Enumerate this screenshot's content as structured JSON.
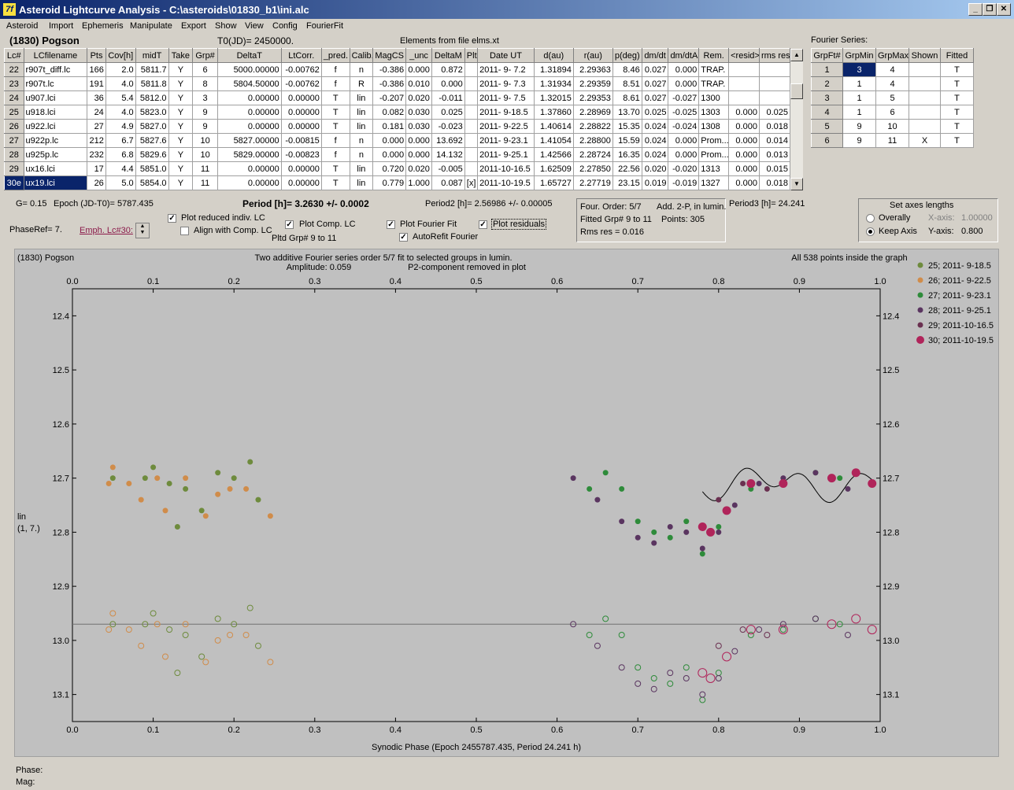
{
  "window": {
    "title": "Asteroid Lightcurve Analysis - C:\\asteroids\\01830_b1\\ini.alc",
    "app_icon": "7f"
  },
  "menu": [
    "Asteroid",
    "Import",
    "Ephemeris",
    "Manipulate",
    "Export",
    "Show",
    "View",
    "Config",
    "FourierFit"
  ],
  "header": {
    "object": "(1830) Pogson",
    "t0": "T0(JD)= 2450000.",
    "elements": "Elements from file elms.xt",
    "fourier_series_label": "Fourier Series:"
  },
  "lc_table": {
    "columns": [
      "Lc#",
      "LCfilename",
      "Pts",
      "Cov[h]",
      "midT",
      "Take",
      "Grp#",
      "DeltaT",
      "LtCorr.",
      "_pred.",
      "Calib.",
      "MagCS",
      "_unc",
      "DeltaM",
      "Plt",
      "Date UT",
      "d(au)",
      "r(au)",
      "p(deg)",
      "dm/dt",
      "dm/dtA",
      "Rem.",
      "<resid>",
      "rms res"
    ],
    "rows": [
      [
        "22",
        "r907t_diff.lc",
        "166",
        "2.0",
        "5811.7",
        "Y",
        "6",
        "5000.00000",
        "-0.00762",
        "f",
        "n",
        "-0.386",
        "0.000",
        "0.872",
        "",
        "2011- 9- 7.2",
        "1.31894",
        "2.29363",
        "8.46",
        "0.027",
        "0.000",
        "TRAP.",
        "",
        ""
      ],
      [
        "23",
        "r907t.lc",
        "191",
        "4.0",
        "5811.8",
        "Y",
        "8",
        "5804.50000",
        "-0.00762",
        "f",
        "R",
        "-0.386",
        "0.010",
        "0.000",
        "",
        "2011- 9- 7.3",
        "1.31934",
        "2.29359",
        "8.51",
        "0.027",
        "0.000",
        "TRAP.",
        "",
        ""
      ],
      [
        "24",
        "u907.lci",
        "36",
        "5.4",
        "5812.0",
        "Y",
        "3",
        "0.00000",
        "0.00000",
        "T",
        "lin",
        "-0.207",
        "0.020",
        "-0.011",
        "",
        "2011- 9- 7.5",
        "1.32015",
        "2.29353",
        "8.61",
        "0.027",
        "-0.027",
        "1300",
        "",
        ""
      ],
      [
        "25",
        "u918.lci",
        "24",
        "4.0",
        "5823.0",
        "Y",
        "9",
        "0.00000",
        "0.00000",
        "T",
        "lin",
        "0.082",
        "0.030",
        "0.025",
        "",
        "2011- 9-18.5",
        "1.37860",
        "2.28969",
        "13.70",
        "0.025",
        "-0.025",
        "1303",
        "0.000",
        "0.025"
      ],
      [
        "26",
        "u922.lci",
        "27",
        "4.9",
        "5827.0",
        "Y",
        "9",
        "0.00000",
        "0.00000",
        "T",
        "lin",
        "0.181",
        "0.030",
        "-0.023",
        "",
        "2011- 9-22.5",
        "1.40614",
        "2.28822",
        "15.35",
        "0.024",
        "-0.024",
        "1308",
        "0.000",
        "0.018"
      ],
      [
        "27",
        "u922p.lc",
        "212",
        "6.7",
        "5827.6",
        "Y",
        "10",
        "5827.00000",
        "-0.00815",
        "f",
        "n",
        "0.000",
        "0.000",
        "13.692",
        "",
        "2011- 9-23.1",
        "1.41054",
        "2.28800",
        "15.59",
        "0.024",
        "0.000",
        "Prom...",
        "0.000",
        "0.014"
      ],
      [
        "28",
        "u925p.lc",
        "232",
        "6.8",
        "5829.6",
        "Y",
        "10",
        "5829.00000",
        "-0.00823",
        "f",
        "n",
        "0.000",
        "0.000",
        "14.132",
        "",
        "2011- 9-25.1",
        "1.42566",
        "2.28724",
        "16.35",
        "0.024",
        "0.000",
        "Prom...",
        "0.000",
        "0.013"
      ],
      [
        "29",
        "ux16.lci",
        "17",
        "4.4",
        "5851.0",
        "Y",
        "11",
        "0.00000",
        "0.00000",
        "T",
        "lin",
        "0.720",
        "0.020",
        "-0.005",
        "",
        "2011-10-16.5",
        "1.62509",
        "2.27850",
        "22.56",
        "0.020",
        "-0.020",
        "1313",
        "0.000",
        "0.015"
      ],
      [
        "30e",
        "ux19.lci",
        "26",
        "5.0",
        "5854.0",
        "Y",
        "11",
        "0.00000",
        "0.00000",
        "T",
        "lin",
        "0.779",
        "1.000",
        "0.087",
        "[x]",
        "2011-10-19.5",
        "1.65727",
        "2.27719",
        "23.15",
        "0.019",
        "-0.019",
        "1327",
        "0.000",
        "0.018"
      ]
    ]
  },
  "fourier_table": {
    "columns": [
      "GrpFt#",
      "GrpMin",
      "GrpMax",
      "Shown",
      "Fitted"
    ],
    "rows": [
      [
        "1",
        "3",
        "4",
        "",
        "T"
      ],
      [
        "2",
        "1",
        "4",
        "",
        "T"
      ],
      [
        "3",
        "1",
        "5",
        "",
        "T"
      ],
      [
        "4",
        "1",
        "6",
        "",
        "T"
      ],
      [
        "5",
        "9",
        "10",
        "",
        "T"
      ],
      [
        "6",
        "9",
        "11",
        "X",
        "T"
      ]
    ]
  },
  "controls": {
    "g": "G= 0.15",
    "epoch": "Epoch (JD-T0)= 5787.435",
    "period": "Period [h]= 3.2630 +/- 0.0002",
    "period2": "Period2 [h]= 2.56986 +/- 0.00005",
    "period3": "Period3 [h]= 24.241",
    "phaseref": "PhaseRef= 7.",
    "emph": "Emph. Lc#30:",
    "plot_reduced": "Plot reduced indiv. LC",
    "align_comp": "Align with Comp. LC",
    "plot_comp": "Plot Comp. LC",
    "pltd_grp": "Pltd Grp#  9   to   11",
    "plot_fourier": "Plot Fourier Fit",
    "autorefit": "AutoRefit Fourier",
    "plot_residuals": "Plot residuals",
    "four_order": "Four. Order:  5/7",
    "add_2p": "Add. 2-P, in lumin.",
    "fitted_grp": "Fitted Grp# 9 to 11",
    "points": "Points: 305",
    "rms": "Rms res      = 0.016",
    "axes_title": "Set axes lengths",
    "overally": "Overally",
    "keep_axis": "Keep Axis",
    "x_axis_label": "X-axis:",
    "x_axis_val": "1.00000",
    "y_axis_label": "Y-axis:",
    "y_axis_val": "0.800"
  },
  "plot": {
    "obj": "(1830) Pogson",
    "line1": "Two additive Fourier series order 5/7 fit to selected groups in lumin.",
    "amp": "Amplitude: 0.059",
    "p2": "P2-component removed in plot",
    "inside": "All 538 points inside the graph",
    "ylabel1": "lin",
    "ylabel2": "(1, 7.)",
    "xlabel": "Synodic Phase (Epoch 2455787.435, Period 24.241 h)",
    "x_ticks": [
      "0.0",
      "0.1",
      "0.2",
      "0.3",
      "0.4",
      "0.5",
      "0.6",
      "0.7",
      "0.8",
      "0.9",
      "1.0"
    ],
    "y_ticks": [
      "12.4",
      "12.5",
      "12.6",
      "12.7",
      "12.8",
      "12.9",
      "13.0",
      "13.1"
    ]
  },
  "chart_data": {
    "type": "scatter",
    "xlabel": "Synodic Phase (Epoch 2455787.435, Period 24.241 h)",
    "ylabel": "lin",
    "xlim": [
      0,
      1
    ],
    "ylim": [
      12.35,
      13.15
    ],
    "y_inverted": true,
    "grid": false,
    "legend_position": "right",
    "series": [
      {
        "name": "25; 2011- 9-18.5",
        "color": "#6e8b3d",
        "x": [
          0.05,
          0.09,
          0.1,
          0.12,
          0.13,
          0.14,
          0.16,
          0.18,
          0.2,
          0.22,
          0.23
        ],
        "y": [
          12.7,
          12.7,
          12.68,
          12.71,
          12.79,
          12.72,
          12.76,
          12.69,
          12.7,
          12.67,
          12.74
        ]
      },
      {
        "name": "26; 2011- 9-22.5",
        "color": "#d08c4a",
        "x": [
          0.045,
          0.05,
          0.07,
          0.085,
          0.105,
          0.115,
          0.14,
          0.165,
          0.18,
          0.195,
          0.215,
          0.245
        ],
        "y": [
          12.71,
          12.68,
          12.71,
          12.74,
          12.7,
          12.76,
          12.7,
          12.77,
          12.73,
          12.72,
          12.72,
          12.77
        ]
      },
      {
        "name": "27; 2011- 9-23.1",
        "color": "#2e8b3a",
        "x": [
          0.64,
          0.66,
          0.68,
          0.7,
          0.72,
          0.74,
          0.76,
          0.78,
          0.8,
          0.84,
          0.88,
          0.92,
          0.95
        ],
        "y": [
          12.72,
          12.69,
          12.72,
          12.78,
          12.8,
          12.81,
          12.78,
          12.84,
          12.79,
          12.72,
          12.71,
          12.69,
          12.7
        ]
      },
      {
        "name": "28; 2011- 9-25.1",
        "color": "#5a3560",
        "x": [
          0.62,
          0.65,
          0.68,
          0.7,
          0.72,
          0.74,
          0.76,
          0.78,
          0.8,
          0.82,
          0.85,
          0.88,
          0.92,
          0.96
        ],
        "y": [
          12.7,
          12.74,
          12.78,
          12.81,
          12.82,
          12.79,
          12.8,
          12.83,
          12.8,
          12.75,
          12.71,
          12.7,
          12.69,
          12.72
        ]
      },
      {
        "name": "29; 2011-10-16.5",
        "color": "#6a3050",
        "x": [
          0.8,
          0.83,
          0.86
        ],
        "y": [
          12.74,
          12.71,
          12.72
        ]
      },
      {
        "name": "30; 2011-10-19.5",
        "color": "#b0245a",
        "x": [
          0.78,
          0.79,
          0.81,
          0.84,
          0.88,
          0.94,
          0.97,
          0.99
        ],
        "y": [
          12.79,
          12.8,
          12.76,
          12.71,
          12.71,
          12.7,
          12.69,
          12.71
        ]
      }
    ],
    "residual_baseline": 12.97
  }
}
